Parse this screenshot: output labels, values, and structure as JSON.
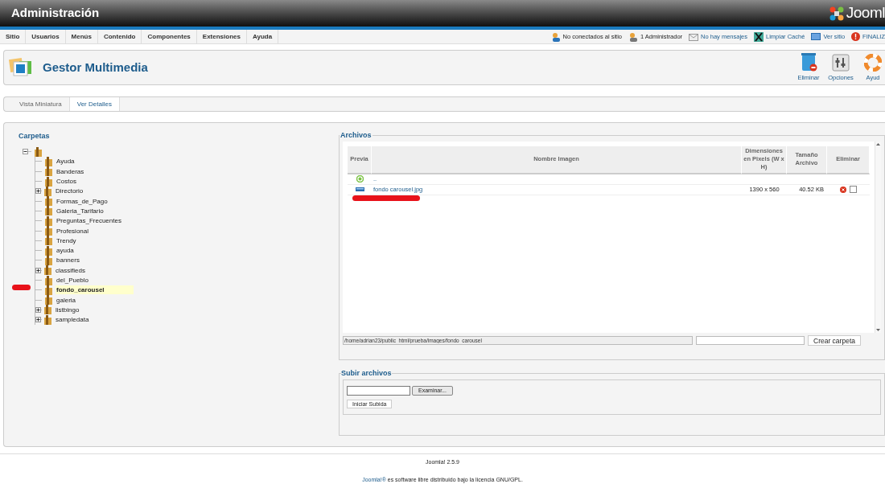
{
  "header": {
    "title": "Administración",
    "logo_text": "Jooml"
  },
  "menu": [
    {
      "label": "Sitio"
    },
    {
      "label": "Usuarios"
    },
    {
      "label": "Menús"
    },
    {
      "label": "Contenido"
    },
    {
      "label": "Componentes"
    },
    {
      "label": "Extensiones"
    },
    {
      "label": "Ayuda"
    }
  ],
  "status": [
    {
      "kind": "users",
      "label": "No conectados al sitio",
      "link": false
    },
    {
      "kind": "admin",
      "label": "1 Administrador",
      "link": false
    },
    {
      "kind": "mail",
      "label": "No hay mensajes",
      "link": true
    },
    {
      "kind": "cache",
      "label": "Limpiar Caché",
      "link": true
    },
    {
      "kind": "site",
      "label": "Ver sitio",
      "link": true
    },
    {
      "kind": "logout",
      "label": "FINALIZ",
      "link": true
    }
  ],
  "toolbar": {
    "title": "Gestor Multimedia",
    "buttons": [
      {
        "kind": "delete",
        "label": "Eliminar"
      },
      {
        "kind": "options",
        "label": "Opciones"
      },
      {
        "kind": "help",
        "label": "Ayud"
      }
    ]
  },
  "view_tabs": [
    {
      "label": "Vista Miniatura",
      "selected": false
    },
    {
      "label": "Ver Detalles",
      "selected": true
    }
  ],
  "folders": {
    "title": "Carpetas",
    "tree": {
      "expanded": true,
      "children": [
        {
          "label": "Ayuda",
          "selected": false
        },
        {
          "label": "Banderas",
          "selected": false
        },
        {
          "label": "Costos",
          "selected": false
        },
        {
          "label": "Directorio",
          "selected": false,
          "expanded": false
        },
        {
          "label": "Formas_de_Pago",
          "selected": false
        },
        {
          "label": "Galeria_Tarifario",
          "selected": false
        },
        {
          "label": "Preguntas_Frecuentes",
          "selected": false
        },
        {
          "label": "Profesional",
          "selected": false
        },
        {
          "label": "Trendy",
          "selected": false
        },
        {
          "label": "ayuda",
          "selected": false
        },
        {
          "label": "banners",
          "selected": false
        },
        {
          "label": "classifieds",
          "selected": false,
          "expanded": false
        },
        {
          "label": "del_Pueblo",
          "selected": false
        },
        {
          "label": "fondo_carousel",
          "selected": true
        },
        {
          "label": "galeria",
          "selected": false
        },
        {
          "label": "listbingo",
          "selected": false,
          "expanded": false
        },
        {
          "label": "sampledata",
          "selected": false,
          "expanded": false
        }
      ]
    }
  },
  "files": {
    "title": "Archivos",
    "columns": [
      "Previa",
      "Nombre Imagen",
      "Dimensiones en Pixels (W x H)",
      "Tamaño Archivo",
      "Eliminar"
    ],
    "rows": [
      {
        "kind": "up",
        "name": ".."
      },
      {
        "kind": "image",
        "name": "fondo carousel.jpg",
        "dimensions": "1390 x 560",
        "size": "40.52 KB",
        "checked": false
      }
    ],
    "path": "/home/adrian23/public_html/prueba/images/fondo_carousel",
    "create_button": "Crear carpeta"
  },
  "upload": {
    "title": "Subir archivos",
    "browse_button": "Examinar...",
    "start_button": "Iniciar Subida"
  },
  "footer": {
    "version": "Joomla! 2.5.9",
    "link": "Joomla!®",
    "license": " es software libre distribuido bajo la licencia GNU/GPL."
  }
}
